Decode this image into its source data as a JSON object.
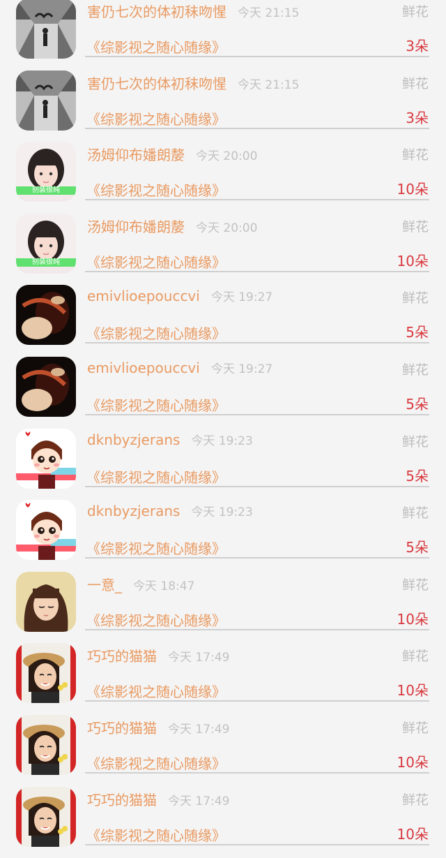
{
  "gift_label": "鲜花",
  "records": [
    {
      "avatar": "silhouette-hall",
      "name": "害仍七次的体初秣吻惺",
      "time": "今天 21:15",
      "book": "《综影视之随心随缘》",
      "quantity": "3朵"
    },
    {
      "avatar": "silhouette-hall",
      "name": "害仍七次的体初秣吻惺",
      "time": "今天 21:15",
      "book": "《综影视之随心随缘》",
      "quantity": "3朵"
    },
    {
      "avatar": "girl-photo-banner",
      "avatar_caption": "别装很纯",
      "name": "汤姆仰布嬏朗嫠",
      "time": "今天 20:00",
      "book": "《综影视之随心随缘》",
      "quantity": "10朵"
    },
    {
      "avatar": "girl-photo-banner",
      "avatar_caption": "别装很纯",
      "name": "汤姆仰布嬏朗嫠",
      "time": "今天 20:00",
      "book": "《综影视之随心随缘》",
      "quantity": "10朵"
    },
    {
      "avatar": "dark-portrait",
      "name": "emivlioepouccvi",
      "time": "今天 19:27",
      "book": "《综影视之随心随缘》",
      "quantity": "5朵"
    },
    {
      "avatar": "dark-portrait",
      "name": "emivlioepouccvi",
      "time": "今天 19:27",
      "book": "《综影视之随心随缘》",
      "quantity": "5朵"
    },
    {
      "avatar": "cartoon-boy",
      "name": "dknbyzjerans",
      "time": "今天 19:23",
      "book": "《综影视之随心随缘》",
      "quantity": "5朵"
    },
    {
      "avatar": "cartoon-boy",
      "name": "dknbyzjerans",
      "time": "今天 19:23",
      "book": "《综影视之随心随缘》",
      "quantity": "5朵"
    },
    {
      "avatar": "anime-girl",
      "name": "一意_",
      "time": "今天 18:47",
      "book": "《综影视之随心随缘》",
      "quantity": "10朵"
    },
    {
      "avatar": "girl-hat-photo",
      "name": "巧巧的猫猫",
      "time": "今天 17:49",
      "book": "《综影视之随心随缘》",
      "quantity": "10朵"
    },
    {
      "avatar": "girl-hat-photo",
      "name": "巧巧的猫猫",
      "time": "今天 17:49",
      "book": "《综影视之随心随缘》",
      "quantity": "10朵"
    },
    {
      "avatar": "girl-hat-photo",
      "name": "巧巧的猫猫",
      "time": "今天 17:49",
      "book": "《综影视之随心随缘》",
      "quantity": "10朵"
    }
  ]
}
